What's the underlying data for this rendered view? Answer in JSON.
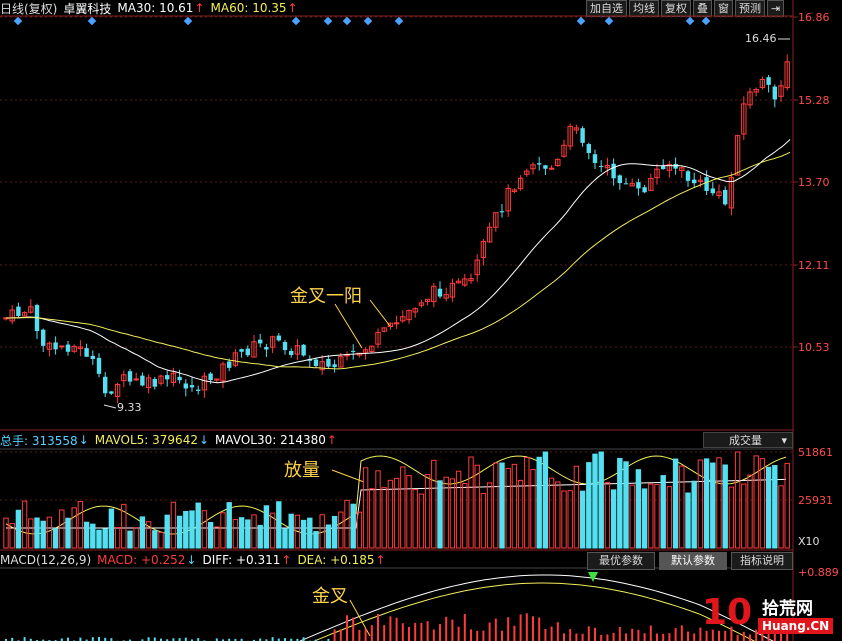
{
  "header": {
    "period": "日线(复权)",
    "stock_name": "卓翼科技",
    "ma30_label": "MA30: 10.61",
    "ma30_arrow": "↑",
    "ma60_label": "MA60: 10.35",
    "ma60_arrow": "↑"
  },
  "toolbar": {
    "buttons": [
      "加自选",
      "均线",
      "复权",
      "叠",
      "窗",
      "预测"
    ],
    "pin_icon": "⇥"
  },
  "price_axis": {
    "labels": [
      "16.86",
      "15.28",
      "13.70",
      "12.11",
      "10.53"
    ]
  },
  "price_marks": {
    "high": "16.46",
    "low": "9.33"
  },
  "annotations": {
    "golden_cross_yang": "金叉一阳",
    "volume_up": "放量",
    "golden_cross": "金叉"
  },
  "volume_bar": {
    "total": "总手: 313558",
    "total_arrow": "↓",
    "mavol5": "MAVOL5: 379642",
    "mavol5_arrow": "↓",
    "mavol30": "MAVOL30: 214380",
    "mavol30_arrow": "↑",
    "selector": "成交量",
    "axis_labels": [
      "51861",
      "25931",
      "X10"
    ]
  },
  "macd_bar": {
    "name": "MACD(12,26,9)",
    "macd": "MACD: +0.252",
    "macd_arrow": "↓",
    "diff": "DIFF: +0.311",
    "diff_arrow": "↑",
    "dea": "DEA: +0.185",
    "dea_arrow": "↑",
    "buttons": [
      "最优参数",
      "默认参数",
      "指标说明"
    ],
    "axis_top": "+0.889"
  },
  "logo": {
    "main": "10",
    "text": "拾荒网",
    "url": "Huang.CN"
  },
  "colors": {
    "up": "#ff3b3b",
    "down": "#54e0f0",
    "ma_white": "#ffffff",
    "ma_yellow": "#f2ee5a"
  }
}
